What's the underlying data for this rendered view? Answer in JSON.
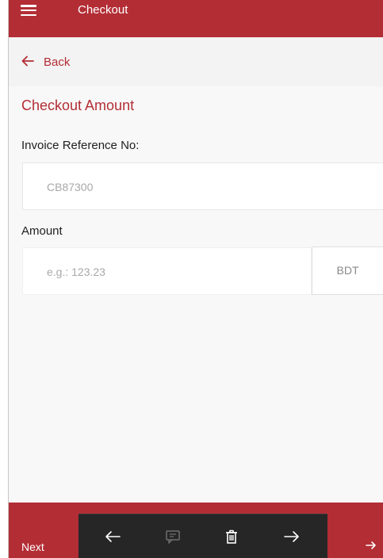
{
  "app_bar": {
    "title": "Checkout",
    "menu_icon": "hamburger-menu-icon"
  },
  "nav": {
    "back_label": "Back",
    "back_icon": "arrow-left-icon"
  },
  "form": {
    "section_title": "Checkout Amount",
    "invoice": {
      "label": "Invoice Reference No:",
      "value": "CB87300"
    },
    "amount": {
      "label": "Amount",
      "placeholder": "e.g.: 123.23",
      "currency": "BDT"
    }
  },
  "footer": {
    "next_label": "Next",
    "next_icon": "arrow-right-icon"
  },
  "overlay_toolbar": {
    "tools": [
      "arrow-left-icon",
      "comment-icon",
      "delete-icon",
      "arrow-right-icon"
    ]
  },
  "colors": {
    "primary": "#b32d35",
    "toolbar_bg": "#262626",
    "background": "#f8f8f8"
  }
}
